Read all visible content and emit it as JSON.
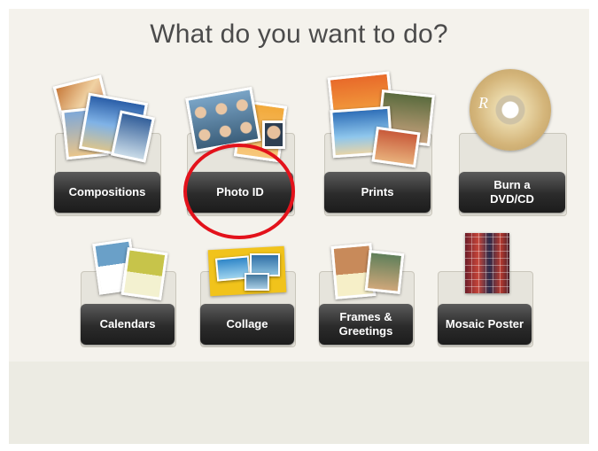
{
  "heading": "What do you want to do?",
  "options": {
    "compositions": "Compositions",
    "photo_id": "Photo ID",
    "prints": "Prints",
    "burn_line1": "Burn a",
    "burn_line2": "DVD/CD",
    "calendars": "Calendars",
    "collage": "Collage",
    "frames_line1": "Frames &",
    "frames_line2": "Greetings",
    "mosaic": "Mosaic Poster"
  },
  "highlight": {
    "target": "Photo ID",
    "color": "#e3121b"
  },
  "dvd_letter": "R"
}
